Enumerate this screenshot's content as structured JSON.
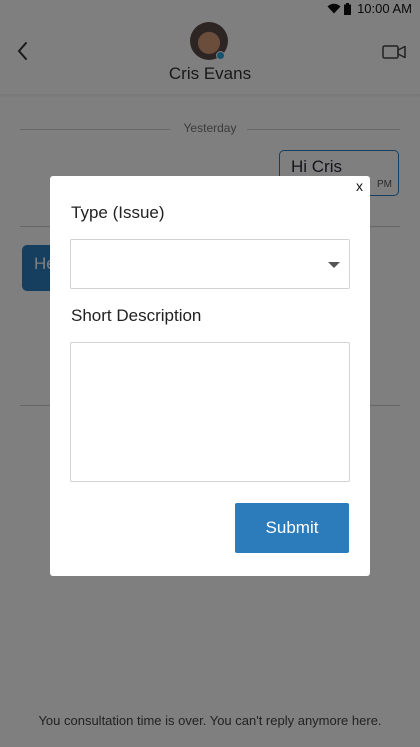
{
  "status_bar": {
    "time": "10:00 AM",
    "icons": [
      "wifi-icon",
      "battery-icon"
    ]
  },
  "header": {
    "contact_name": "Cris Evans",
    "online": true
  },
  "chat": {
    "date_separator": "Yesterday",
    "messages": [
      {
        "side": "right",
        "text": "Hi Cris",
        "time": "PM"
      },
      {
        "side": "left",
        "text": "He"
      }
    ],
    "footer_note": "You consultation time is over. You can't reply anymore here."
  },
  "modal": {
    "close_label": "x",
    "type_label": "Type (Issue)",
    "type_value": "",
    "description_label": "Short Description",
    "description_value": "",
    "submit_label": "Submit"
  },
  "colors": {
    "accent": "#2c7cbc",
    "online_dot": "#2aa6e0"
  }
}
